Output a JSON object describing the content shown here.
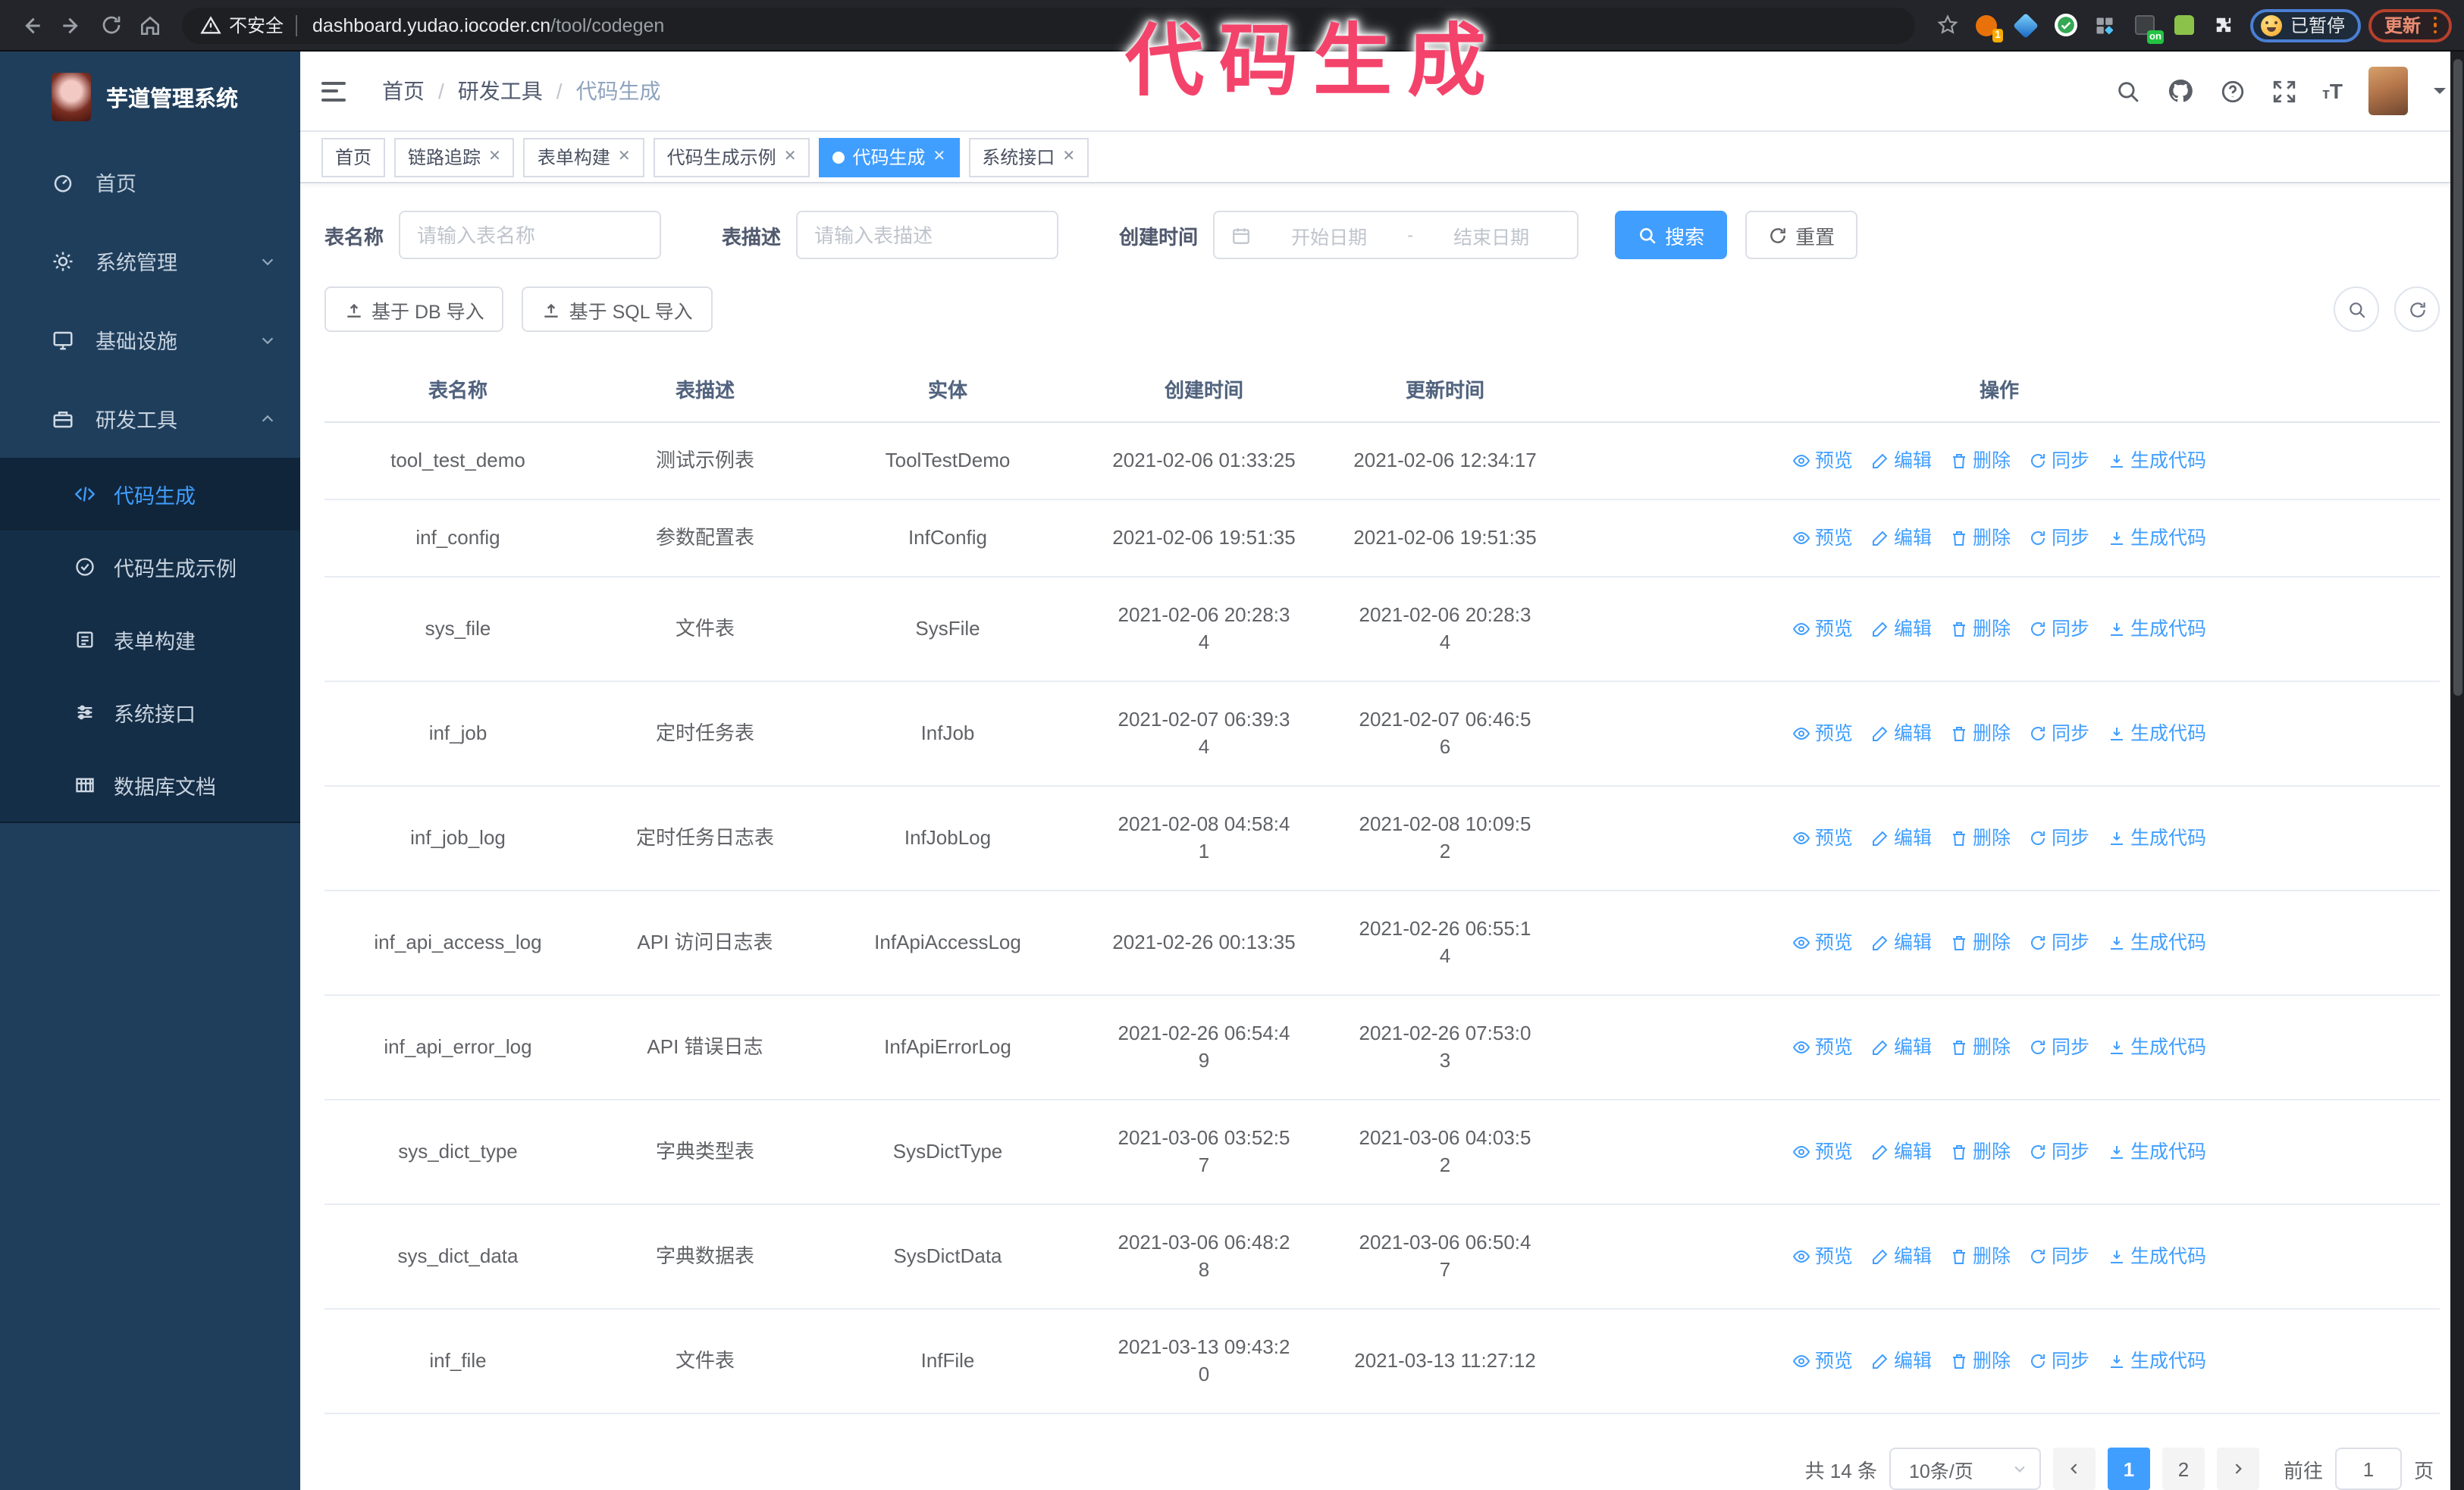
{
  "browser": {
    "security_warning": "不安全",
    "url_host": "dashboard.yudao.iocoder.cn",
    "url_path": "/tool/codegen",
    "extension_badge_1": "1",
    "extension_badge_on": "on",
    "paused_badge": "已暂停",
    "update_button": "更新"
  },
  "annotation": {
    "text": "代码生成",
    "color": "#f4436b"
  },
  "sidebar": {
    "title": "芋道管理系统",
    "items": [
      {
        "label": "首页"
      },
      {
        "label": "系统管理"
      },
      {
        "label": "基础设施"
      },
      {
        "label": "研发工具"
      }
    ],
    "submenu": [
      {
        "label": "代码生成"
      },
      {
        "label": "代码生成示例"
      },
      {
        "label": "表单构建"
      },
      {
        "label": "系统接口"
      },
      {
        "label": "数据库文档"
      }
    ]
  },
  "header": {
    "breadcrumb": [
      "首页",
      "研发工具",
      "代码生成"
    ]
  },
  "tabs": [
    {
      "label": "首页"
    },
    {
      "label": "链路追踪"
    },
    {
      "label": "表单构建"
    },
    {
      "label": "代码生成示例"
    },
    {
      "label": "代码生成"
    },
    {
      "label": "系统接口"
    }
  ],
  "search_form": {
    "table_name_label": "表名称",
    "table_name_placeholder": "请输入表名称",
    "table_desc_label": "表描述",
    "table_desc_placeholder": "请输入表描述",
    "create_time_label": "创建时间",
    "start_placeholder": "开始日期",
    "range_separator": "-",
    "end_placeholder": "结束日期",
    "search_label": "搜索",
    "reset_label": "重置"
  },
  "toolbar": {
    "import_db_label": "基于 DB 导入",
    "import_sql_label": "基于 SQL 导入"
  },
  "table": {
    "columns": [
      "表名称",
      "表描述",
      "实体",
      "创建时间",
      "更新时间",
      "操作"
    ],
    "actions": [
      "预览",
      "编辑",
      "删除",
      "同步",
      "生成代码"
    ],
    "rows": [
      {
        "name": "tool_test_demo",
        "desc": "测试示例表",
        "entity": "ToolTestDemo",
        "create_time": "2021-02-06 01:33:25",
        "update_time": "2021-02-06 12:34:17"
      },
      {
        "name": "inf_config",
        "desc": "参数配置表",
        "entity": "InfConfig",
        "create_time": "2021-02-06 19:51:35",
        "update_time": "2021-02-06 19:51:35"
      },
      {
        "name": "sys_file",
        "desc": "文件表",
        "entity": "SysFile",
        "create_time": "2021-02-06 20:28:3\n4",
        "update_time": "2021-02-06 20:28:3\n4"
      },
      {
        "name": "inf_job",
        "desc": "定时任务表",
        "entity": "InfJob",
        "create_time": "2021-02-07 06:39:3\n4",
        "update_time": "2021-02-07 06:46:5\n6"
      },
      {
        "name": "inf_job_log",
        "desc": "定时任务日志表",
        "entity": "InfJobLog",
        "create_time": "2021-02-08 04:58:4\n1",
        "update_time": "2021-02-08 10:09:5\n2"
      },
      {
        "name": "inf_api_access_log",
        "desc": "API 访问日志表",
        "entity": "InfApiAccessLog",
        "create_time": "2021-02-26 00:13:35",
        "update_time": "2021-02-26 06:55:1\n4"
      },
      {
        "name": "inf_api_error_log",
        "desc": "API 错误日志",
        "entity": "InfApiErrorLog",
        "create_time": "2021-02-26 06:54:4\n9",
        "update_time": "2021-02-26 07:53:0\n3"
      },
      {
        "name": "sys_dict_type",
        "desc": "字典类型表",
        "entity": "SysDictType",
        "create_time": "2021-03-06 03:52:5\n7",
        "update_time": "2021-03-06 04:03:5\n2"
      },
      {
        "name": "sys_dict_data",
        "desc": "字典数据表",
        "entity": "SysDictData",
        "create_time": "2021-03-06 06:48:2\n8",
        "update_time": "2021-03-06 06:50:4\n7"
      },
      {
        "name": "inf_file",
        "desc": "文件表",
        "entity": "InfFile",
        "create_time": "2021-03-13 09:43:2\n0",
        "update_time": "2021-03-13 11:27:12"
      }
    ]
  },
  "pagination": {
    "total_text": "共 14 条",
    "page_size": "10条/页",
    "pages": [
      "1",
      "2"
    ],
    "active_page": "1",
    "goto_label": "前往",
    "goto_value": "1",
    "page_suffix": "页"
  },
  "colors": {
    "accent": "#409eff",
    "annotation": "#f4436b",
    "sidebar_bg": "#1f3e5c",
    "submenu_bg": "#152e47",
    "chrome_bg": "#23252a",
    "update_accent": "#e8694f",
    "paused_border": "#4a7fd4"
  }
}
